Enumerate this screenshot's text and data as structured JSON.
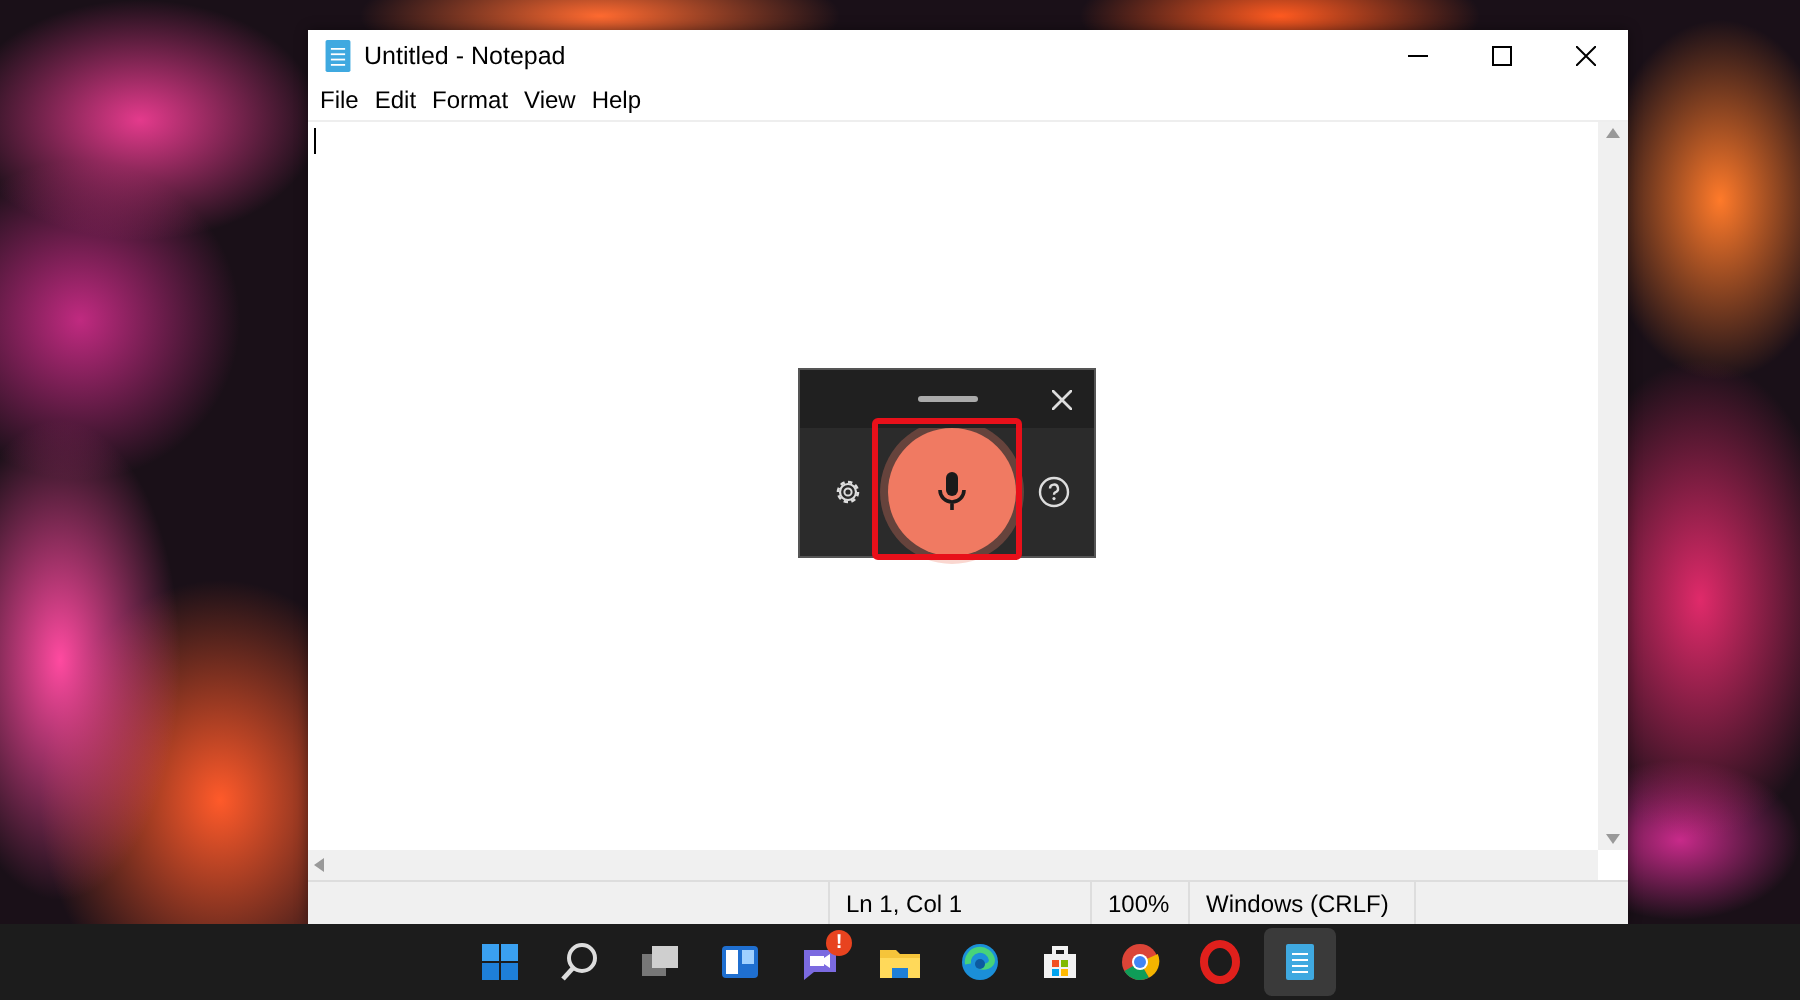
{
  "window": {
    "title": "Untitled - Notepad"
  },
  "menu": [
    "File",
    "Edit",
    "Format",
    "View",
    "Help"
  ],
  "status_bar": {
    "cells": [
      "Ln 1, Col 1",
      "100%",
      "Windows (CRLF)"
    ]
  },
  "voice_typing": {
    "recording": true,
    "highlighted": true
  },
  "taskbar": {
    "items": [
      {
        "kind": "start",
        "selected": false
      },
      {
        "kind": "search",
        "selected": false
      },
      {
        "kind": "taskview",
        "selected": false
      },
      {
        "kind": "widgets",
        "selected": false
      },
      {
        "kind": "chat",
        "selected": false,
        "badge": "!"
      },
      {
        "kind": "explorer",
        "selected": false
      },
      {
        "kind": "edge",
        "selected": false
      },
      {
        "kind": "store",
        "selected": false
      },
      {
        "kind": "chrome",
        "selected": false
      },
      {
        "kind": "opera",
        "selected": false
      },
      {
        "kind": "notepad",
        "selected": true
      }
    ]
  }
}
